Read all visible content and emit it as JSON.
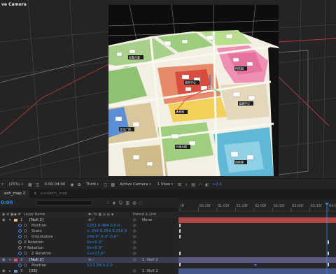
{
  "viewer": {
    "view_name": "ve Camera",
    "footer": {
      "zoom": "(25%)",
      "timecode": "0:00:04:00",
      "resolution": "Third",
      "view": "Active Camera",
      "views": "1 View",
      "exposure": "+0.0"
    }
  },
  "map": {
    "labels": [
      "金融大厦",
      "商务中心",
      "科技园",
      "会展中心",
      "体育馆",
      "文化广场",
      "行政大楼",
      "创新港"
    ]
  },
  "timeline": {
    "tabs": [
      {
        "label": "ech_map 2",
        "active": true
      },
      {
        "label": "yunitech_map",
        "active": false
      }
    ],
    "timecode": "0:00",
    "column_headers": {
      "layer_name": "Layer Name",
      "parent": "Parent & Link"
    },
    "ruler_ticks": [
      "0f",
      "00:15f",
      "01:00f",
      "01:15f",
      "02:00f",
      "02:15f",
      "03:00f",
      "03:15f",
      "04:0"
    ],
    "layers": [
      {
        "num": "1",
        "name": "[Null 2]",
        "parent": "None",
        "selected": false,
        "label_color": "#e0c070"
      },
      {
        "num": "2",
        "name": "[Null 2]",
        "parent": "1. Null 2",
        "selected": true,
        "label_color": "#e85a5a"
      },
      {
        "num": "3",
        "name": "[02]",
        "parent": "1. Null 2",
        "selected": false,
        "label_color": "#6f8fd8"
      }
    ],
    "properties": [
      {
        "name": "Position",
        "value": "1252.0,964.0,0.0"
      },
      {
        "name": "Scale",
        "value": "∞ 254.9,254.9,254.9"
      },
      {
        "name": "Orientation",
        "value": "299.9°,0.0°,0.0°"
      },
      {
        "name": "X Rotation",
        "value": "0x+0.0°"
      },
      {
        "name": "Y Rotation",
        "value": "0x+0.0°"
      },
      {
        "name": "Z Rotation",
        "value": "1x+23.6°"
      }
    ],
    "layer2_property": {
      "name": "Position",
      "value": "13.5,58.5,0.0"
    },
    "colors": {
      "accent": "#2d8ceb",
      "track_red": "#b84545",
      "track_selected": "#5a5a82",
      "track_blue": "#46588a"
    }
  }
}
